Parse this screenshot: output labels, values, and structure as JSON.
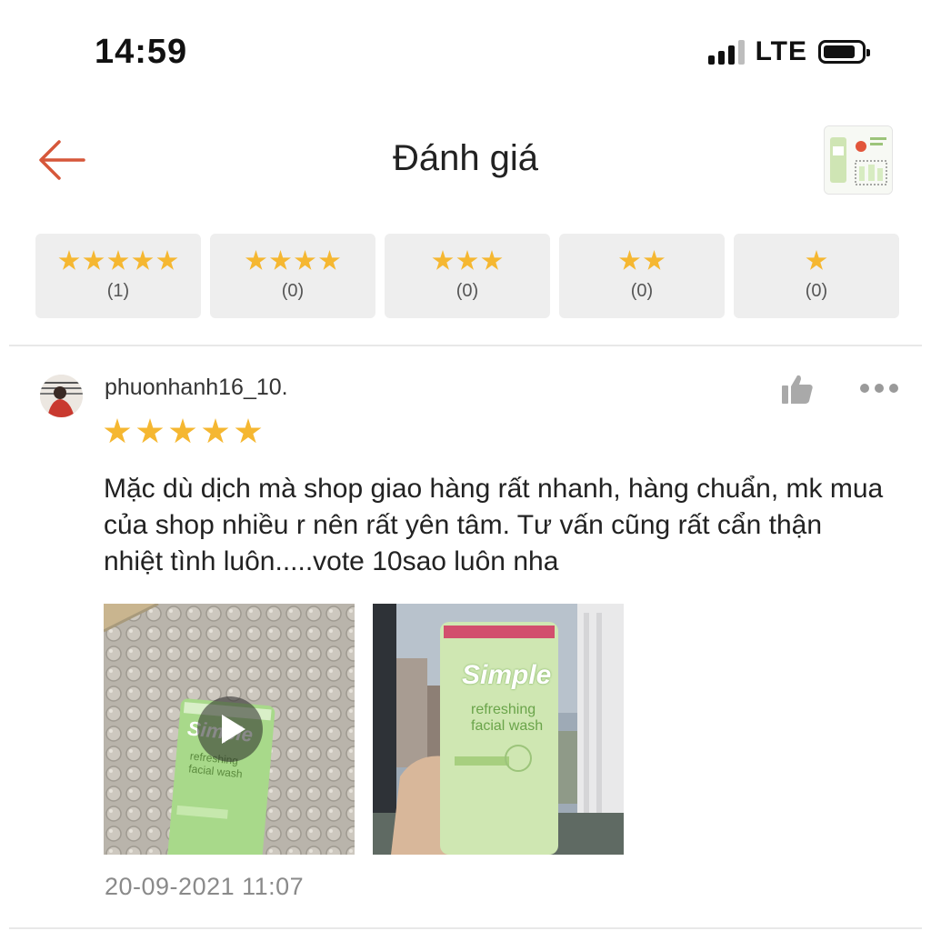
{
  "status_bar": {
    "time": "14:59",
    "network": "LTE",
    "signal_bars": 3,
    "signal_max": 4
  },
  "header": {
    "title": "Đánh giá",
    "back_icon": "arrow-left-icon"
  },
  "rating_filters": [
    {
      "stars": 5,
      "count": "(1)"
    },
    {
      "stars": 4,
      "count": "(0)"
    },
    {
      "stars": 3,
      "count": "(0)"
    },
    {
      "stars": 2,
      "count": "(0)"
    },
    {
      "stars": 1,
      "count": "(0)"
    }
  ],
  "review": {
    "username": "phuonhanh16_10.",
    "rating": 5,
    "text": "Mặc dù dịch mà shop giao hàng rất nhanh, hàng chuẩn, mk mua của shop nhiều r nên rất yên tâm. Tư vấn cũng rất cẩn thận nhiệt tình luôn.....vote 10sao luôn nha",
    "media": [
      {
        "kind": "video",
        "brand": "Simple",
        "caption": "refreshing facial wash"
      },
      {
        "kind": "image",
        "brand": "Simple",
        "caption": "refreshing facial wash"
      }
    ],
    "timestamp": "20-09-2021 11:07"
  },
  "colors": {
    "accent": "#d6573a",
    "star": "#f5b731",
    "chip_bg": "#eeeeee"
  }
}
